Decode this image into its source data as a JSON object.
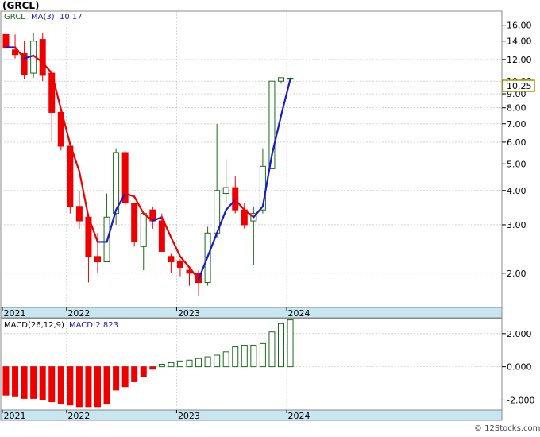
{
  "title": "(GRCL)",
  "watermark": "© 12Stocks.com",
  "colors": {
    "up": "#1a6b1a",
    "down": "#ee0000",
    "ma_down": "#ee0000",
    "ma_up": "#1a1acc",
    "axis_band": "#c8e6f0",
    "grid": "#bbbbbb",
    "last_price_box": "#9a9a00"
  },
  "chart_data": [
    {
      "type": "candlestick",
      "legend": {
        "symbol": "GRCL",
        "ma_label": "MA(3)",
        "ma_value": "10.17"
      },
      "scale": "log",
      "ylim": [
        1.5,
        18.0
      ],
      "y_ticks": [
        {
          "value": 16,
          "label": "16.00"
        },
        {
          "value": 14,
          "label": "14.00"
        },
        {
          "value": 12,
          "label": "12.00"
        },
        {
          "value": 10,
          "label": "10.00"
        },
        {
          "value": 9,
          "label": "9.00"
        },
        {
          "value": 8,
          "label": "8.00"
        },
        {
          "value": 7,
          "label": "7.00"
        },
        {
          "value": 6,
          "label": "6.00"
        },
        {
          "value": 5,
          "label": "5.00"
        },
        {
          "value": 4,
          "label": "4.00"
        },
        {
          "value": 3,
          "label": "3.00"
        },
        {
          "value": 2,
          "label": "2.00"
        }
      ],
      "last_price": "10.25",
      "x_labels": [
        "2021",
        "2022",
        "2023",
        "2024"
      ],
      "candles": [
        {
          "o": 14.8,
          "h": 17.0,
          "l": 12.3,
          "c": 13.2
        },
        {
          "o": 13.0,
          "h": 14.8,
          "l": 12.1,
          "c": 12.5
        },
        {
          "o": 12.6,
          "h": 14.0,
          "l": 10.2,
          "c": 10.6
        },
        {
          "o": 10.7,
          "h": 15.0,
          "l": 10.3,
          "c": 14.0
        },
        {
          "o": 14.2,
          "h": 15.0,
          "l": 10.0,
          "c": 10.5
        },
        {
          "o": 10.7,
          "h": 11.0,
          "l": 6.0,
          "c": 7.7
        },
        {
          "o": 7.7,
          "h": 7.9,
          "l": 5.6,
          "c": 5.8
        },
        {
          "o": 5.8,
          "h": 5.9,
          "l": 3.3,
          "c": 3.5
        },
        {
          "o": 3.5,
          "h": 4.0,
          "l": 2.9,
          "c": 3.1
        },
        {
          "o": 3.2,
          "h": 3.3,
          "l": 1.85,
          "c": 2.3
        },
        {
          "o": 2.3,
          "h": 2.8,
          "l": 2.0,
          "c": 2.2
        },
        {
          "o": 2.2,
          "h": 3.9,
          "l": 2.2,
          "c": 3.2
        },
        {
          "o": 3.3,
          "h": 5.7,
          "l": 3.0,
          "c": 5.5
        },
        {
          "o": 5.5,
          "h": 5.6,
          "l": 3.5,
          "c": 3.6
        },
        {
          "o": 3.6,
          "h": 3.6,
          "l": 2.5,
          "c": 2.6
        },
        {
          "o": 2.5,
          "h": 3.1,
          "l": 2.05,
          "c": 3.3
        },
        {
          "o": 3.4,
          "h": 3.5,
          "l": 2.9,
          "c": 3.1
        },
        {
          "o": 3.1,
          "h": 3.3,
          "l": 2.4,
          "c": 2.4
        },
        {
          "o": 2.3,
          "h": 2.35,
          "l": 2.0,
          "c": 2.2
        },
        {
          "o": 2.2,
          "h": 2.25,
          "l": 1.95,
          "c": 2.1
        },
        {
          "o": 2.05,
          "h": 2.1,
          "l": 1.8,
          "c": 2.0
        },
        {
          "o": 2.0,
          "h": 2.05,
          "l": 1.65,
          "c": 1.85
        },
        {
          "o": 1.85,
          "h": 2.95,
          "l": 1.8,
          "c": 2.8
        },
        {
          "o": 2.8,
          "h": 7.0,
          "l": 2.7,
          "c": 4.0
        },
        {
          "o": 3.9,
          "h": 5.2,
          "l": 3.6,
          "c": 4.1
        },
        {
          "o": 4.1,
          "h": 4.5,
          "l": 3.3,
          "c": 3.4
        },
        {
          "o": 3.4,
          "h": 3.6,
          "l": 2.9,
          "c": 3.0
        },
        {
          "o": 3.1,
          "h": 3.5,
          "l": 2.15,
          "c": 3.3
        },
        {
          "o": 3.4,
          "h": 5.7,
          "l": 3.3,
          "c": 4.9
        },
        {
          "o": 4.8,
          "h": 10.0,
          "l": 4.7,
          "c": 10.0
        },
        {
          "o": 10.0,
          "h": 10.3,
          "l": 9.8,
          "c": 10.3
        },
        {
          "o": 10.2,
          "h": 10.3,
          "l": 10.1,
          "c": 10.25
        }
      ],
      "ma": [
        13.3,
        13.3,
        12.1,
        12.4,
        11.7,
        10.7,
        7.9,
        5.9,
        4.7,
        3.2,
        2.6,
        2.6,
        3.4,
        3.9,
        3.8,
        3.3,
        3.1,
        3.2,
        2.7,
        2.3,
        2.1,
        1.9,
        2.3,
        2.8,
        3.4,
        3.7,
        3.4,
        3.2,
        3.5,
        5.4,
        7.5,
        10.17
      ]
    },
    {
      "type": "bar",
      "legend": {
        "label": "MACD(26,12,9)",
        "value_label": "MACD:2.823"
      },
      "ylim": [
        -2.6,
        2.9
      ],
      "y_ticks": [
        {
          "value": 2,
          "label": "2.000"
        },
        {
          "value": 0,
          "label": "0.000"
        },
        {
          "value": -2,
          "label": "-2.000"
        }
      ],
      "x_labels": [
        "2021",
        "2022",
        "2023",
        "2024"
      ],
      "values": [
        -1.7,
        -1.8,
        -1.9,
        -1.9,
        -2.0,
        -2.1,
        -2.2,
        -2.3,
        -2.4,
        -2.4,
        -2.4,
        -2.2,
        -1.4,
        -1.2,
        -0.9,
        -0.6,
        -0.15,
        0.15,
        0.25,
        0.35,
        0.4,
        0.5,
        0.6,
        0.7,
        0.9,
        1.2,
        1.3,
        1.3,
        1.4,
        2.1,
        2.6,
        2.823
      ]
    }
  ]
}
